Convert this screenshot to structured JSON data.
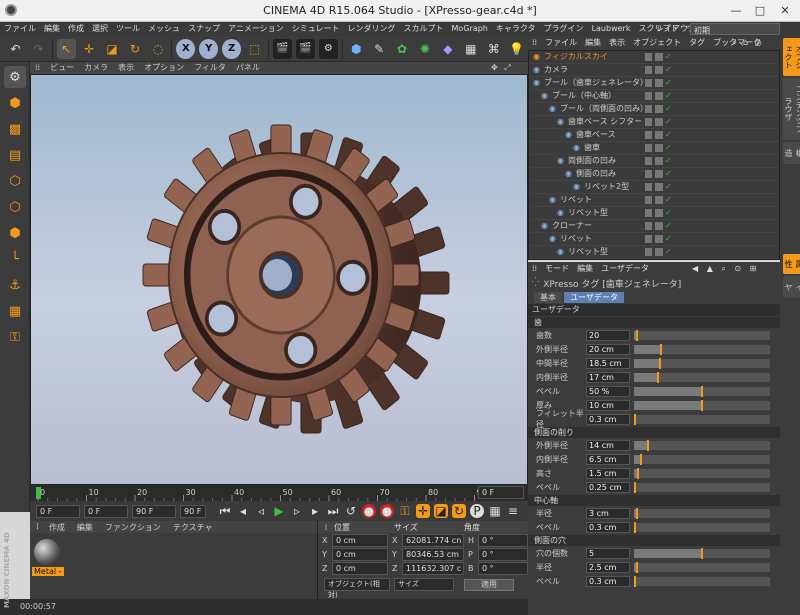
{
  "window": {
    "title": "CINEMA 4D R15.064 Studio - [XPresso-gear.c4d *]"
  },
  "menubar": {
    "items": [
      "ファイル",
      "編集",
      "作成",
      "選択",
      "ツール",
      "メッシュ",
      "スナップ",
      "アニメーション",
      "シミュレート",
      "レンダリング",
      "スカルプト",
      "MoGraph",
      "キャラクタ",
      "プラグイン",
      "Laubwerk",
      "スクリプト",
      "ウインドウ",
      "ヘルプ"
    ],
    "layout_label": "レイアウト:",
    "layout_value": "初期"
  },
  "viewport": {
    "menu": [
      "ビュー",
      "カメラ",
      "表示",
      "オプション",
      "フィルタ",
      "パネル"
    ]
  },
  "timeline": {
    "ticks": [
      "0",
      "10",
      "20",
      "30",
      "40",
      "50",
      "60",
      "70",
      "80",
      "90"
    ],
    "current_frame": "0 F",
    "start": "0 F",
    "min": "0 F",
    "max": "90 F",
    "end": "90 F"
  },
  "material": {
    "menu": [
      "作成",
      "編集",
      "ファンクション",
      "テクスチャ"
    ],
    "swatch_label": "Metal -"
  },
  "coords": {
    "headers": [
      "位置",
      "サイズ",
      "角度"
    ],
    "rows": [
      {
        "axis": "X",
        "pos": "0 cm",
        "size_axis": "X",
        "size": "62081.774 cn",
        "rot_axis": "H",
        "rot": "0 °"
      },
      {
        "axis": "Y",
        "pos": "0 cm",
        "size_axis": "Y",
        "size": "80346.53 cm",
        "rot_axis": "P",
        "rot": "0 °"
      },
      {
        "axis": "Z",
        "pos": "0 cm",
        "size_axis": "Z",
        "size": "111632.307 c",
        "rot_axis": "B",
        "rot": "0 °"
      }
    ],
    "mode_a": "オブジェクト(相対)",
    "mode_b": "サイズ",
    "apply": "適用"
  },
  "status": {
    "time": "00:00:57"
  },
  "brand": {
    "line1": "MAXON",
    "line2": "CINEMA 4D"
  },
  "objects": {
    "menu": [
      "ファイル",
      "編集",
      "表示",
      "オブジェクト",
      "タグ",
      "ブックマーク"
    ],
    "tree": [
      {
        "label": "フィジカルスカイ",
        "indent": 0,
        "highlight": true
      },
      {
        "label": "カメラ",
        "indent": 0
      },
      {
        "label": "ブール（歯車ジェネレータ）",
        "indent": 0
      },
      {
        "label": "ブール（中心軸）",
        "indent": 1
      },
      {
        "label": "ブール（両側面の凹み）",
        "indent": 2
      },
      {
        "label": "歯車ベース シフター",
        "indent": 3
      },
      {
        "label": "歯車ベース",
        "indent": 4
      },
      {
        "label": "歯車",
        "indent": 5
      },
      {
        "label": "両側面の凹み",
        "indent": 3
      },
      {
        "label": "側面の凹み",
        "indent": 4
      },
      {
        "label": "リベット2型",
        "indent": 5
      },
      {
        "label": "リベット",
        "indent": 2
      },
      {
        "label": "リベット型",
        "indent": 3
      },
      {
        "label": "クローナー",
        "indent": 1
      },
      {
        "label": "リベット",
        "indent": 2
      },
      {
        "label": "リベット型",
        "indent": 3
      }
    ]
  },
  "attributes": {
    "menu": [
      "モード",
      "編集",
      "ユーザデータ"
    ],
    "object_title": "XPresso タグ [歯車ジェネレータ]",
    "tabs": [
      "基本",
      "ユーザデータ"
    ],
    "section_title": "ユーザデータ",
    "groups": [
      {
        "title": "歯",
        "params": [
          {
            "label": "歯数",
            "value": "20",
            "level": 0.02
          },
          {
            "label": "外側半径",
            "value": "20 cm",
            "level": 0.2
          },
          {
            "label": "中間半径",
            "value": "18.5 cm",
            "level": 0.19
          },
          {
            "label": "内側半径",
            "value": "17 cm",
            "level": 0.18
          },
          {
            "label": "ベベル",
            "value": "50 %",
            "level": 0.5
          },
          {
            "label": "厚み",
            "value": "10 cm",
            "level": 0.5
          },
          {
            "label": "フィレット半径",
            "value": "0.3 cm",
            "level": 0.01
          }
        ]
      },
      {
        "title": "側面の削り",
        "params": [
          {
            "label": "外側半径",
            "value": "14 cm",
            "level": 0.1
          },
          {
            "label": "内側半径",
            "value": "6.5 cm",
            "level": 0.05
          },
          {
            "label": "高さ",
            "value": "1.5 cm",
            "level": 0.03
          },
          {
            "label": "ベベル",
            "value": "0.25 cm",
            "level": 0.01
          }
        ]
      },
      {
        "title": "中心軸",
        "params": [
          {
            "label": "半径",
            "value": "3 cm",
            "level": 0.02
          },
          {
            "label": "ベベル",
            "value": "0.3 cm",
            "level": 0.01
          }
        ]
      },
      {
        "title": "側面の穴",
        "params": [
          {
            "label": "穴の個数",
            "value": "5",
            "level": 0.5
          },
          {
            "label": "半径",
            "value": "2.5 cm",
            "level": 0.02
          },
          {
            "label": "ベベル",
            "value": "0.3 cm",
            "level": 0.01
          }
        ]
      }
    ]
  },
  "right_tabs": [
    "オブジェクト",
    "コンテンツブラウザ",
    "構造"
  ],
  "right_tabs_lower": [
    "属性",
    "レイヤ"
  ]
}
